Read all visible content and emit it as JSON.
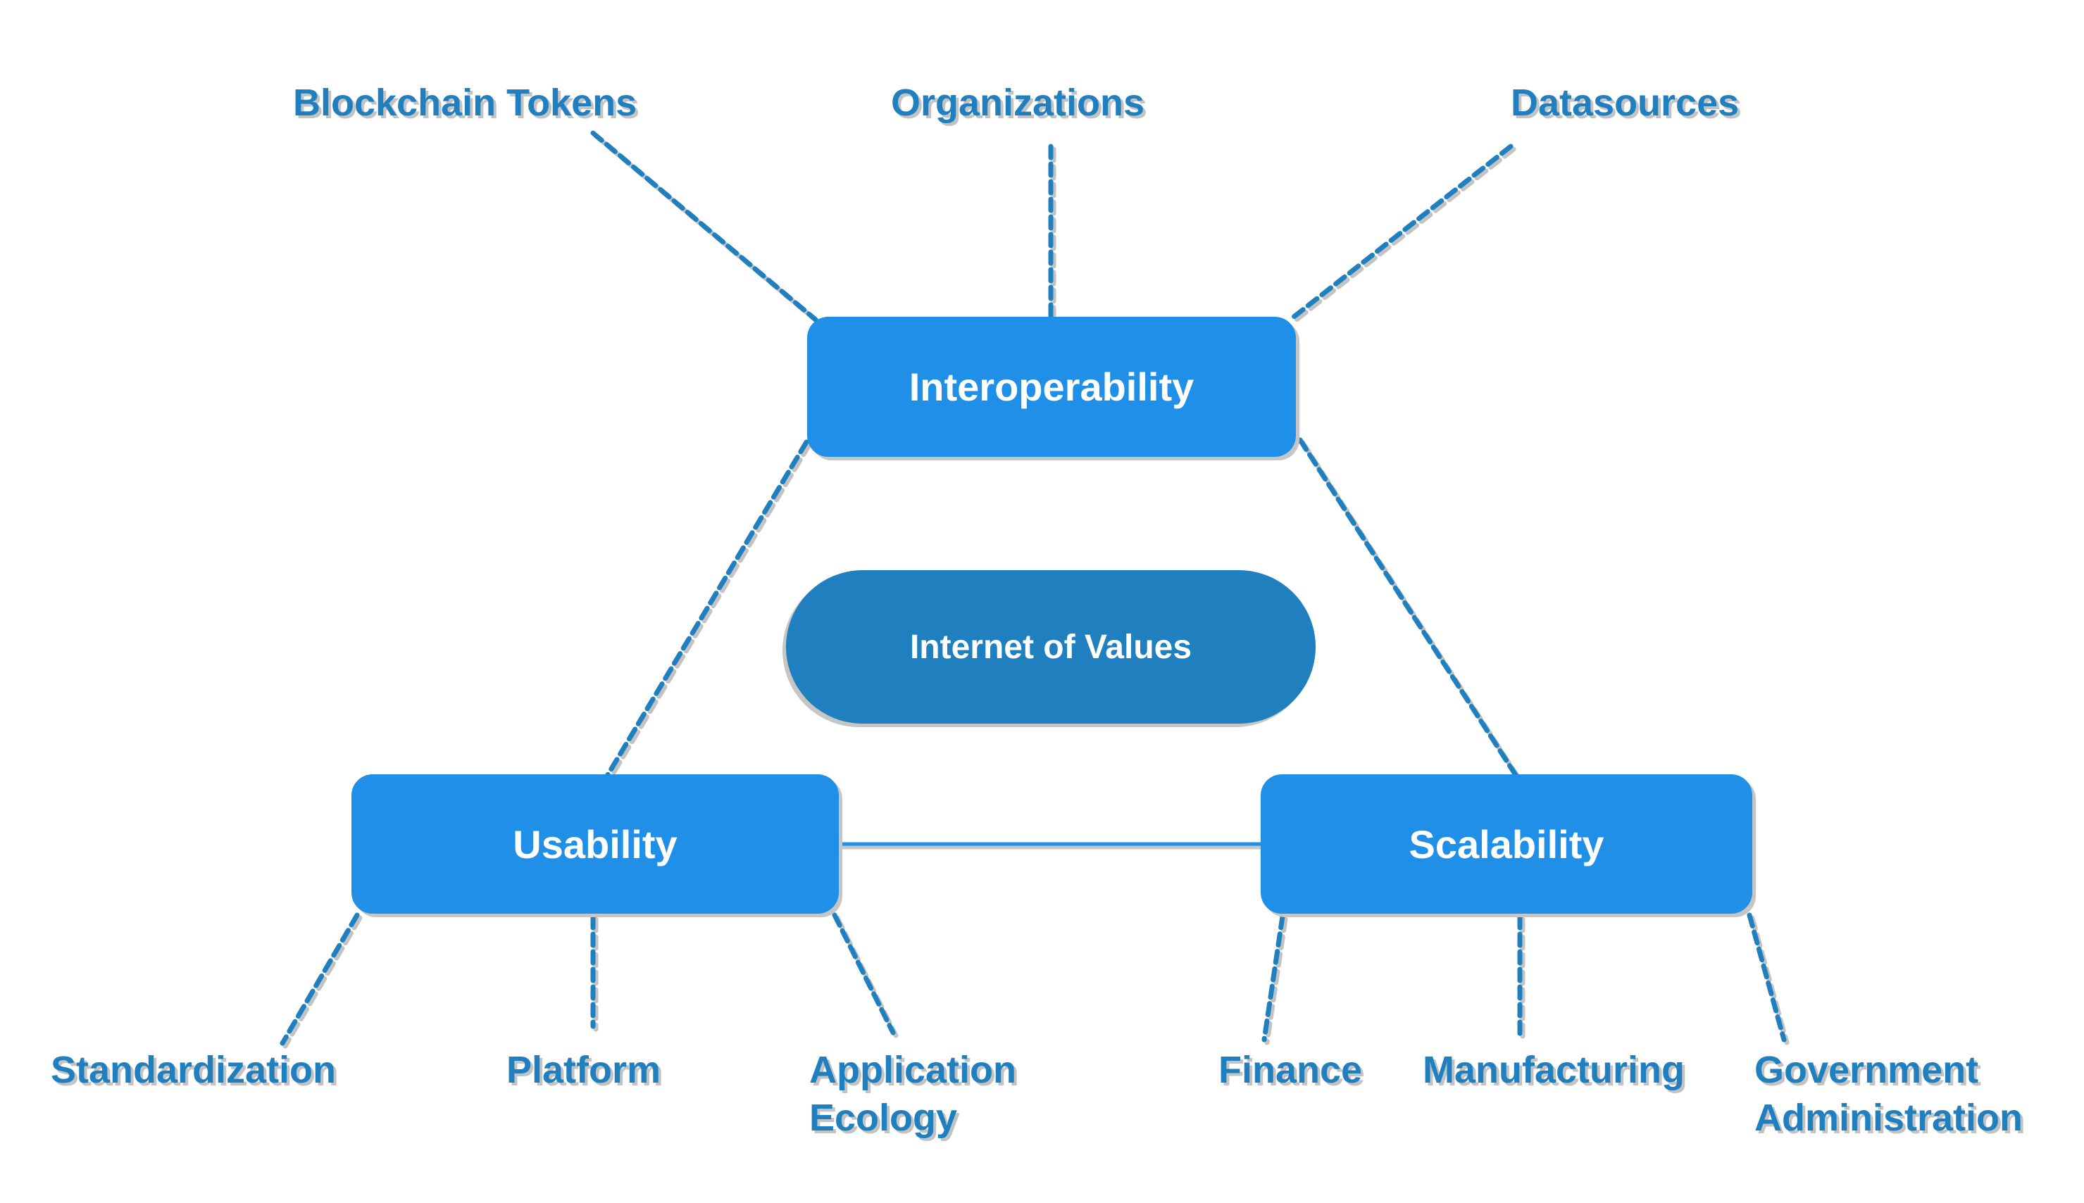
{
  "diagram": {
    "center": {
      "label": "Internet of Values"
    },
    "nodes": {
      "interoperability": {
        "label": "Interoperability",
        "children": [
          "Blockchain Tokens",
          "Organizations",
          "Datasources"
        ]
      },
      "usability": {
        "label": "Usability",
        "children": [
          "Standardization",
          "Platform",
          "Application Ecology"
        ]
      },
      "scalability": {
        "label": "Scalability",
        "children": [
          "Finance",
          "Manufacturing",
          "Government Administration"
        ]
      }
    },
    "labels": {
      "blockchain_tokens": "Blockchain Tokens",
      "organizations": "Organizations",
      "datasources": "Datasources",
      "standardization": "Standardization",
      "platform": "Platform",
      "application_1": "Application",
      "application_2": "Ecology",
      "finance": "Finance",
      "manufacturing": "Manufacturing",
      "government_1": "Government",
      "government_2": "Administration"
    },
    "colors": {
      "node": "#1f8fe8",
      "center": "#1f7fbf",
      "text": "#1f7fbf",
      "line": "#1f7fbf"
    }
  }
}
